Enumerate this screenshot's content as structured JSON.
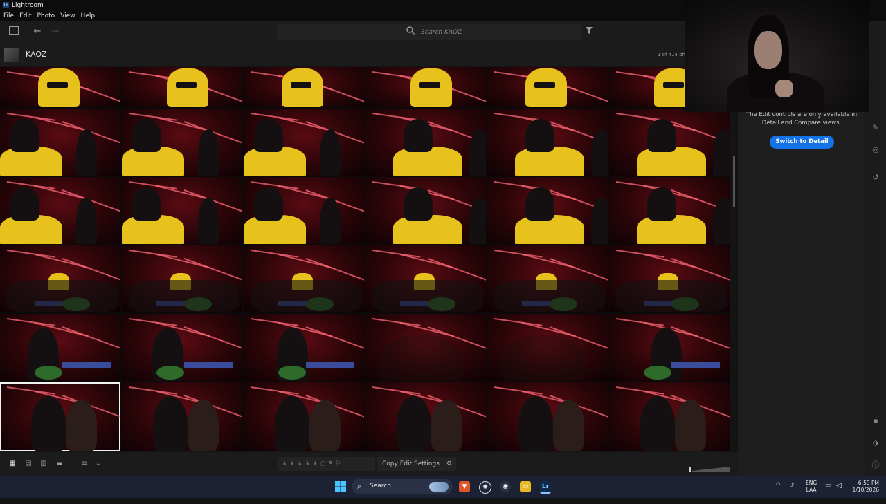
{
  "window": {
    "title": "Lightroom",
    "logo": "Lr"
  },
  "menu": [
    "File",
    "Edit",
    "Photo",
    "View",
    "Help"
  ],
  "toolbar": {
    "search_placeholder": "Search KAOZ"
  },
  "album": {
    "name": "KAOZ",
    "count": "1 of 414 ph"
  },
  "right_panel": {
    "message": "The Edit controls are only available in Detail and Compare views.",
    "switch_button": "Switch to Detail"
  },
  "bottom": {
    "copy_edit": "Copy Edit Settings"
  },
  "taskbar": {
    "search_label": "Search",
    "app_lr": "Lr",
    "lang": "ENG",
    "lang2": "LAA",
    "time": "6:59 PM",
    "date": "1/10/2026"
  },
  "colors": {
    "accent": "#1473e6",
    "stage_red": "#5a0b12",
    "jacket_yellow": "#e7c21d"
  },
  "grid": {
    "rows": [
      {
        "scene": "yellow-closeup",
        "count": 6
      },
      {
        "scene": "singer-mic",
        "count": 6
      },
      {
        "scene": "singer-mic-crowd",
        "count": 6
      },
      {
        "scene": "crowd-stage",
        "count": 6
      },
      {
        "scene": "dj-booth",
        "count": 6
      },
      {
        "scene": "couple-pose",
        "count": 6
      }
    ],
    "selected_index": 30
  }
}
